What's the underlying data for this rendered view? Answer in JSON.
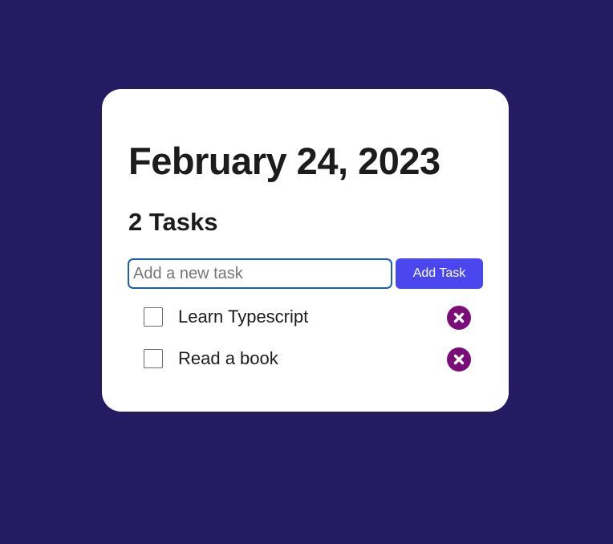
{
  "header": {
    "date": "February 24, 2023",
    "task_count": "2 Tasks"
  },
  "new_task": {
    "placeholder": "Add a new task",
    "value": "",
    "add_button_label": "Add Task"
  },
  "tasks": [
    {
      "label": "Learn Typescript",
      "checked": false,
      "delete_icon": "close-circle-icon"
    },
    {
      "label": "Read a book",
      "checked": false,
      "delete_icon": "close-circle-icon"
    }
  ],
  "colors": {
    "background": "#251b63",
    "card": "#ffffff",
    "accent_button": "#4a47ef",
    "delete_icon": "#7a0d7a",
    "input_focus_border": "#1a5fb4"
  }
}
